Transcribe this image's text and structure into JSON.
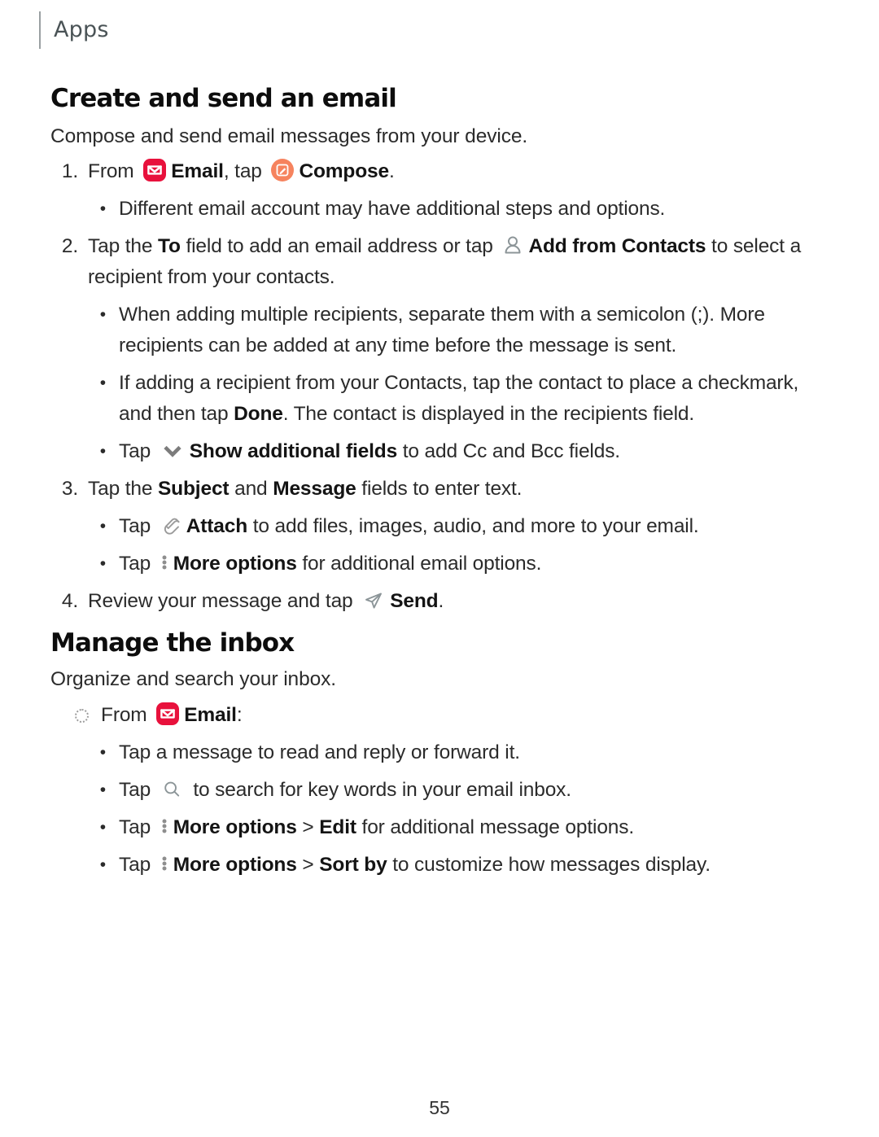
{
  "header": {
    "running_head": "Apps"
  },
  "sections": [
    {
      "id": "create",
      "title": "Create and send an email",
      "lead": "Compose and send email messages from your device."
    },
    {
      "id": "manage",
      "title": "Manage the inbox",
      "lead": "Organize and search your inbox."
    }
  ],
  "create_steps": {
    "s1_num": "1.",
    "s1_a": "From ",
    "s1_email": "Email",
    "s1_b": ", tap ",
    "s1_compose": "Compose",
    "s1_c": ".",
    "s1_sub_bullet": "•",
    "s1_sub": "Different email account may have additional steps and options.",
    "s2_num": "2.",
    "s2_a": "Tap the ",
    "s2_to": "To",
    "s2_b": " field to add an email address or tap ",
    "s2_contacts": "Add from Contacts",
    "s2_c": " to select a recipient from your contacts.",
    "s2_sub1_bullet": "•",
    "s2_sub1": "When adding multiple recipients, separate them with a semicolon (;). More recipients can be added at any time before the message is sent.",
    "s2_sub2_bullet": "•",
    "s2_sub2_a": "If adding a recipient from your Contacts, tap the contact to place a checkmark, and then tap ",
    "s2_sub2_done": "Done",
    "s2_sub2_b": ". The contact is displayed in the recipients field.",
    "s2_sub3_bullet": "•",
    "s2_sub3_a": "Tap ",
    "s2_sub3_show": "Show additional fields",
    "s2_sub3_b": " to add Cc and Bcc fields.",
    "s3_num": "3.",
    "s3_a": "Tap the ",
    "s3_subject": "Subject",
    "s3_b": " and ",
    "s3_message": "Message",
    "s3_c": " fields to enter text.",
    "s3_sub1_bullet": "•",
    "s3_sub1_a": "Tap ",
    "s3_sub1_attach": "Attach",
    "s3_sub1_b": " to add files, images, audio, and more to your email.",
    "s3_sub2_bullet": "•",
    "s3_sub2_a": "Tap ",
    "s3_sub2_more": "More options",
    "s3_sub2_b": " for additional email options.",
    "s4_num": "4.",
    "s4_a": "Review your message and tap ",
    "s4_send": "Send",
    "s4_b": "."
  },
  "manage_steps": {
    "m1_a": "From ",
    "m1_email": "Email",
    "m1_b": ":",
    "m1_sub1_bullet": "•",
    "m1_sub1": "Tap a message to read and reply or forward it.",
    "m1_sub2_bullet": "•",
    "m1_sub2_a": "Tap ",
    "m1_sub2_b": " to search for key words in your email inbox.",
    "m1_sub3_bullet": "•",
    "m1_sub3_a": "Tap ",
    "m1_sub3_more": "More options",
    "m1_sub3_sep": " > ",
    "m1_sub3_edit": "Edit",
    "m1_sub3_b": " for additional message options.",
    "m1_sub4_bullet": "•",
    "m1_sub4_a": "Tap ",
    "m1_sub4_more": "More options",
    "m1_sub4_sep": " > ",
    "m1_sub4_sort": "Sort by",
    "m1_sub4_b": " to customize how messages display."
  },
  "icons": {
    "email": "email-app-icon",
    "compose": "compose-icon",
    "contacts": "add-from-contacts-icon",
    "chevron": "chevron-down-icon",
    "attach": "paperclip-icon",
    "more": "more-options-icon",
    "send": "send-icon",
    "search": "search-icon"
  },
  "colors": {
    "email_red": "#E8113C",
    "compose_orange": "#F6835E",
    "icon_gray": "#8C9598",
    "rule_gray": "#9AA0A2",
    "text": "#2B2B2B"
  },
  "footer": {
    "page_number": "55"
  }
}
